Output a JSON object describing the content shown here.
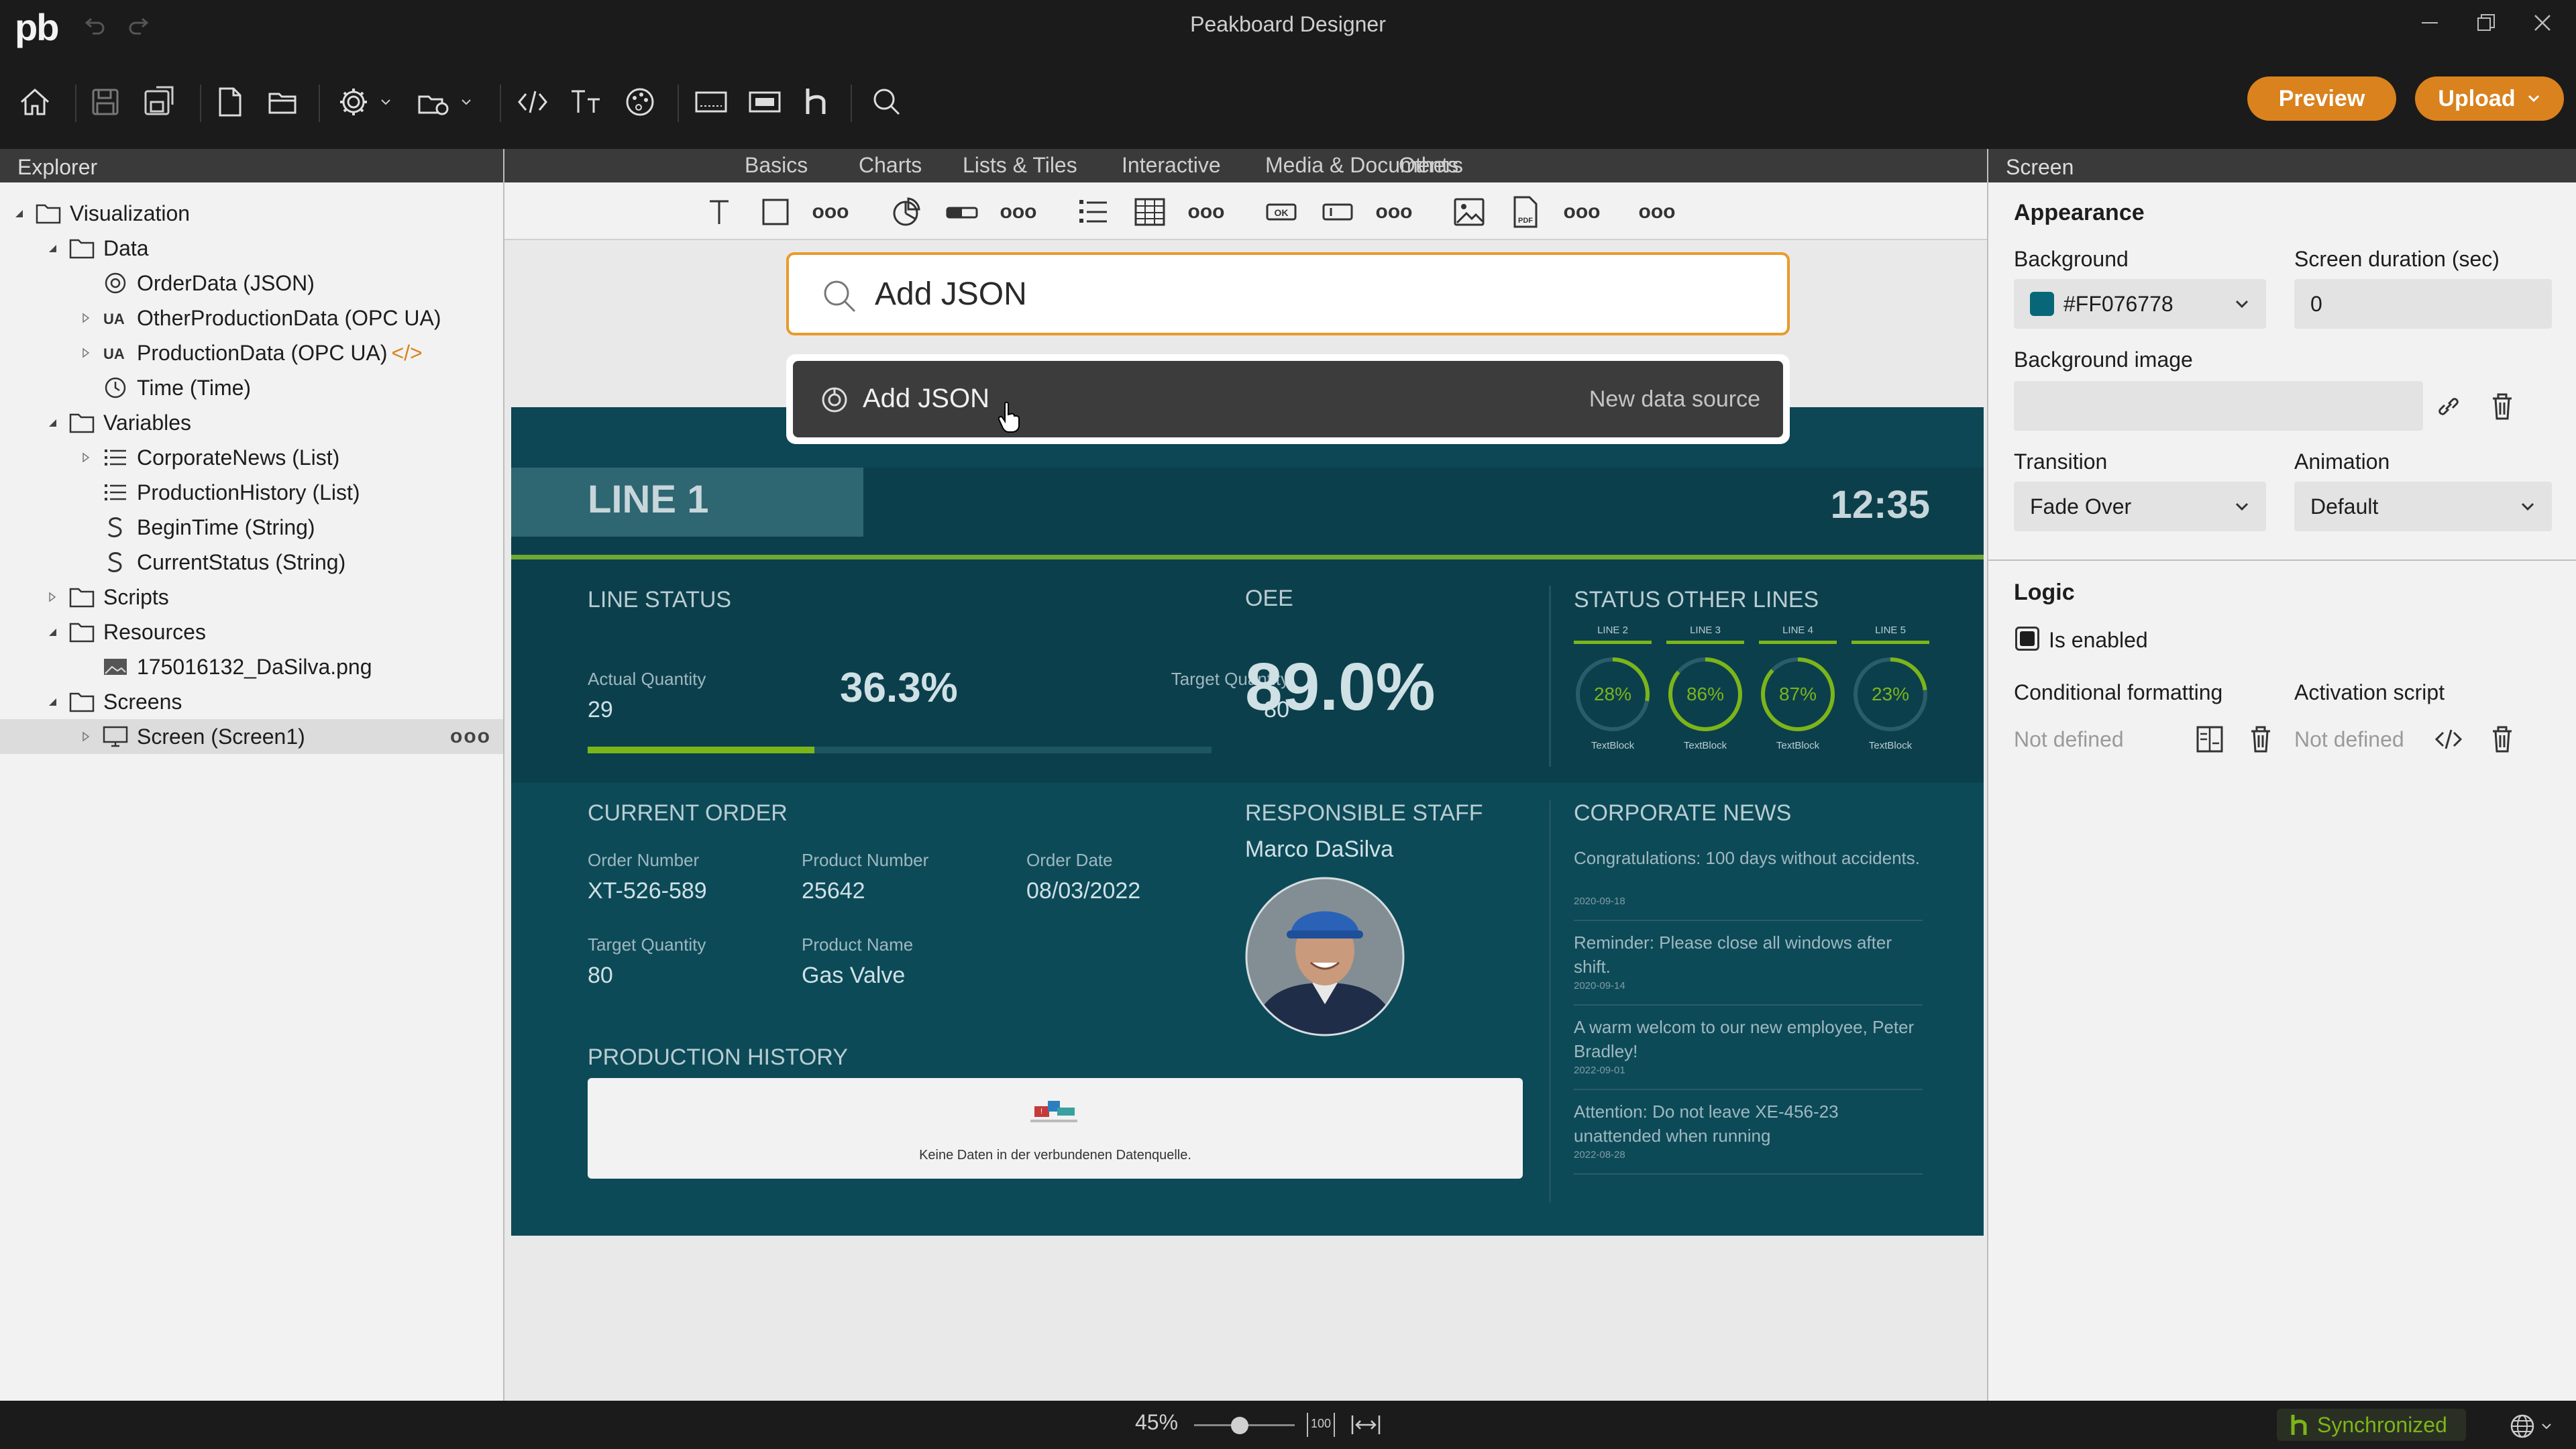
{
  "app": {
    "logo": "pb",
    "title": "Peakboard Designer"
  },
  "toolbar": {
    "preview_label": "Preview",
    "upload_label": "Upload"
  },
  "explorer": {
    "title": "Explorer",
    "items": [
      {
        "label": "Visualization",
        "icon": "folder-icon"
      },
      {
        "label": "Data",
        "icon": "folder-icon"
      },
      {
        "label": "OrderData (JSON)",
        "icon": "json-icon"
      },
      {
        "label": "OtherProductionData (OPC UA)",
        "icon": "opcua-icon"
      },
      {
        "label": "ProductionData (OPC UA)",
        "icon": "opcua-icon",
        "tag": "</>"
      },
      {
        "label": "Time (Time)",
        "icon": "clock-icon"
      },
      {
        "label": "Variables",
        "icon": "folder-icon"
      },
      {
        "label": "CorporateNews (List)",
        "icon": "list-icon"
      },
      {
        "label": "ProductionHistory (List)",
        "icon": "list-icon"
      },
      {
        "label": "BeginTime (String)",
        "icon": "string-icon"
      },
      {
        "label": "CurrentStatus (String)",
        "icon": "string-icon"
      },
      {
        "label": "Scripts",
        "icon": "folder-icon"
      },
      {
        "label": "Resources",
        "icon": "folder-icon"
      },
      {
        "label": "175016132_DaSilva.png",
        "icon": "image-icon"
      },
      {
        "label": "Screens",
        "icon": "folder-icon"
      },
      {
        "label": "Screen (Screen1)",
        "icon": "screen-icon",
        "more": "ooo"
      }
    ]
  },
  "categories": [
    "Basics",
    "Charts",
    "Lists & Tiles",
    "Interactive",
    "Media & Documents",
    "Others"
  ],
  "controls_more": "ooo",
  "search": {
    "value": "Add JSON",
    "result_label": "Add JSON",
    "result_hint": "New data source"
  },
  "dashboard": {
    "line": "LINE 1",
    "time": "12:35",
    "line_status_title": "LINE STATUS",
    "actual_qty_label": "Actual Quantity",
    "actual_qty": "29",
    "progress_pct_text": "36.3%",
    "progress": 0.363,
    "target_qty_label": "Target Quantity",
    "target_qty": "80",
    "oee_title": "OEE",
    "oee_value": "89.0%",
    "status_other_title": "STATUS OTHER LINES",
    "other_lines": [
      {
        "name": "LINE 2",
        "value": "28%",
        "footer": "TextBlock"
      },
      {
        "name": "LINE 3",
        "value": "86%",
        "footer": "TextBlock"
      },
      {
        "name": "LINE 4",
        "value": "87%",
        "footer": "TextBlock"
      },
      {
        "name": "LINE 5",
        "value": "23%",
        "footer": "TextBlock"
      }
    ],
    "current_order_title": "CURRENT ORDER",
    "order_number_label": "Order Number",
    "order_number": "XT-526-589",
    "product_number_label": "Product Number",
    "product_number": "25642",
    "order_date_label": "Order Date",
    "order_date": "08/03/2022",
    "order_target_label": "Target Quantity",
    "order_target": "80",
    "product_name_label": "Product Name",
    "product_name": "Gas Valve",
    "staff_title": "RESPONSIBLE STAFF",
    "staff_name": "Marco DaSilva",
    "news_title": "CORPORATE NEWS",
    "news": [
      {
        "text": "Congratulations: 100 days without accidents.",
        "date": "2020-09-18"
      },
      {
        "text": "Reminder: Please close all windows after shift.",
        "date": "2020-09-14"
      },
      {
        "text": "A warm welcom to our new employee, Peter Bradley!",
        "date": "2022-09-01"
      },
      {
        "text": "Attention: Do not leave XE-456-23 unattended when running",
        "date": "2022-08-28"
      }
    ],
    "history_title": "PRODUCTION HISTORY",
    "history_empty": "Keine Daten in der verbundenen Datenquelle."
  },
  "properties": {
    "title": "Screen",
    "appearance_title": "Appearance",
    "background_label": "Background",
    "background_value": "#FF076778",
    "background_swatch": "#076778",
    "duration_label": "Screen duration (sec)",
    "duration_value": "0",
    "bg_image_label": "Background image",
    "transition_label": "Transition",
    "transition_value": "Fade Over",
    "animation_label": "Animation",
    "animation_value": "Default",
    "logic_title": "Logic",
    "enabled_label": "Is enabled",
    "cond_label": "Conditional formatting",
    "cond_value": "Not defined",
    "activation_label": "Activation script",
    "activation_value": "Not defined"
  },
  "statusbar": {
    "zoom": "45%",
    "zoom_level": 0.45,
    "fit_label": "100",
    "sync_label": "Synchronized"
  },
  "colors": {
    "accent": "#d9821e",
    "dash_bg": "#0c3f4c",
    "progress": "#7cb518",
    "sync": "#7cb518"
  }
}
